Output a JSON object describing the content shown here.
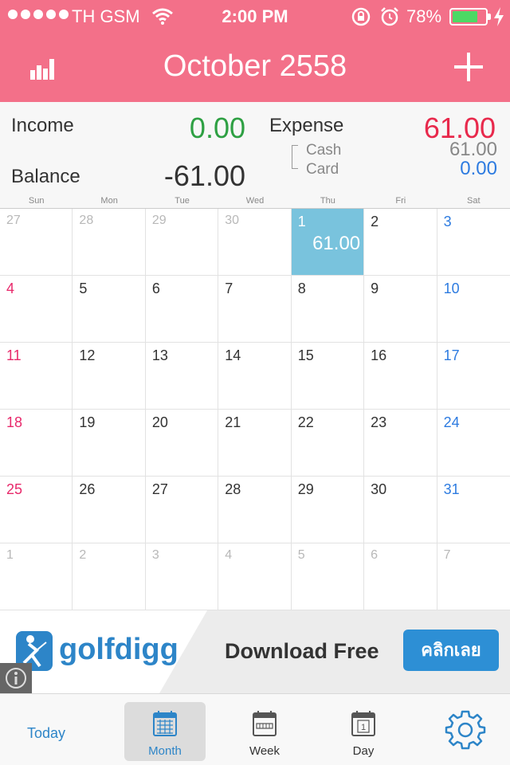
{
  "status_bar": {
    "carrier": "TH GSM",
    "time": "2:00 PM",
    "battery_pct": "78%",
    "battery_level": 0.78
  },
  "header": {
    "title": "October 2558"
  },
  "summary": {
    "income_label": "Income",
    "income_value": "0.00",
    "expense_label": "Expense",
    "expense_value": "61.00",
    "balance_label": "Balance",
    "balance_value": "-61.00",
    "cash_label": "Cash",
    "cash_value": "61.00",
    "card_label": "Card",
    "card_value": "0.00"
  },
  "weekdays": [
    "Sun",
    "Mon",
    "Tue",
    "Wed",
    "Thu",
    "Fri",
    "Sat"
  ],
  "calendar": {
    "days": [
      {
        "n": "27",
        "other": true
      },
      {
        "n": "28",
        "other": true
      },
      {
        "n": "29",
        "other": true
      },
      {
        "n": "30",
        "other": true
      },
      {
        "n": "1",
        "selected": true,
        "amount": "61.00"
      },
      {
        "n": "2"
      },
      {
        "n": "3"
      },
      {
        "n": "4"
      },
      {
        "n": "5"
      },
      {
        "n": "6"
      },
      {
        "n": "7"
      },
      {
        "n": "8"
      },
      {
        "n": "9"
      },
      {
        "n": "10"
      },
      {
        "n": "11"
      },
      {
        "n": "12"
      },
      {
        "n": "13"
      },
      {
        "n": "14"
      },
      {
        "n": "15"
      },
      {
        "n": "16"
      },
      {
        "n": "17"
      },
      {
        "n": "18"
      },
      {
        "n": "19"
      },
      {
        "n": "20"
      },
      {
        "n": "21"
      },
      {
        "n": "22"
      },
      {
        "n": "23"
      },
      {
        "n": "24"
      },
      {
        "n": "25"
      },
      {
        "n": "26"
      },
      {
        "n": "27"
      },
      {
        "n": "28"
      },
      {
        "n": "29"
      },
      {
        "n": "30"
      },
      {
        "n": "31"
      },
      {
        "n": "1",
        "other": true
      },
      {
        "n": "2",
        "other": true
      },
      {
        "n": "3",
        "other": true
      },
      {
        "n": "4",
        "other": true
      },
      {
        "n": "5",
        "other": true
      },
      {
        "n": "6",
        "other": true
      },
      {
        "n": "7",
        "other": true
      }
    ]
  },
  "ad": {
    "brand": "golfdigg",
    "cta_text": "Download Free",
    "button_label": "คลิกเลย"
  },
  "tabs": {
    "today": "Today",
    "month": "Month",
    "week": "Week",
    "day": "Day",
    "day_icon_number": "1"
  },
  "colors": {
    "header_bg": "#f37089",
    "income": "#2ea043",
    "expense": "#e8294c",
    "accent_blue": "#2d85c8",
    "selected_day": "#79c3dd"
  }
}
